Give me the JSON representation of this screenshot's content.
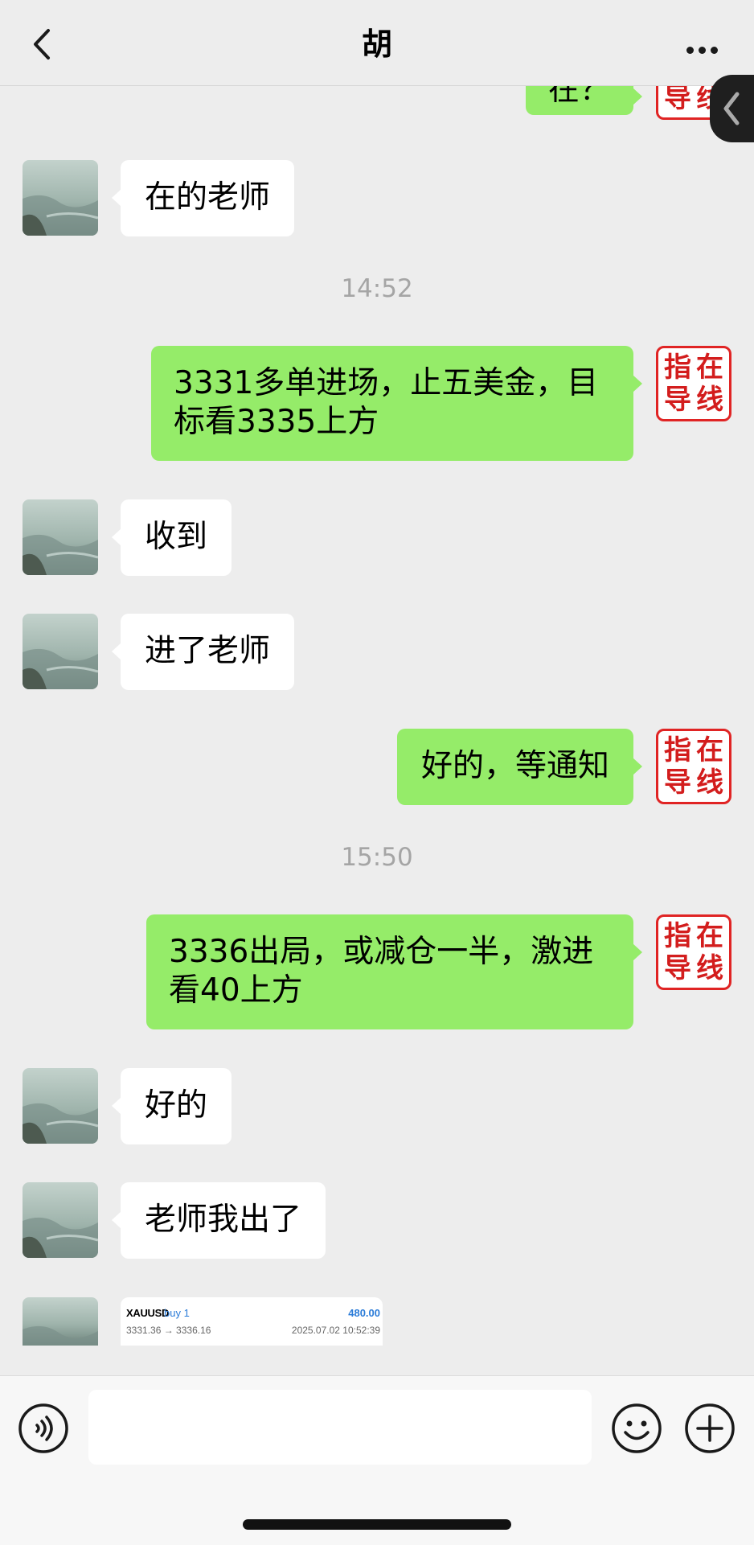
{
  "header": {
    "title": "胡"
  },
  "stamp_chars": [
    "指",
    "在",
    "导",
    "线"
  ],
  "messages": {
    "m0": {
      "text": "在？"
    },
    "m1": {
      "text": "在的老师"
    },
    "t1": {
      "text": "14:52"
    },
    "m2": {
      "text": "3331多单进场，止五美金，目标看3335上方"
    },
    "m3": {
      "text": "收到"
    },
    "m4": {
      "text": "进了老师"
    },
    "m5": {
      "text": "好的，等通知"
    },
    "t2": {
      "text": "15:50"
    },
    "m6": {
      "text": "3336出局，或减仓一半，激进看40上方"
    },
    "m7": {
      "text": "好的"
    },
    "m8": {
      "text": "老师我出了"
    }
  },
  "trade_card": {
    "symbol": "XAUUSD",
    "type": "buy 1",
    "profit": "480.00",
    "prices": "3331.36 → 3336.16",
    "time": "2025.07.02 10:52:39"
  },
  "colors": {
    "outgoing_bubble": "#95ec69",
    "incoming_bubble": "#ffffff",
    "stamp_red": "#e02424",
    "background": "#ededed"
  },
  "icons": {
    "back": "chevron-left-icon",
    "more": "more-dots-icon",
    "voice": "voice-icon",
    "emoji": "emoji-icon",
    "add": "plus-circle-icon",
    "side_tab": "chevron-left-icon"
  }
}
